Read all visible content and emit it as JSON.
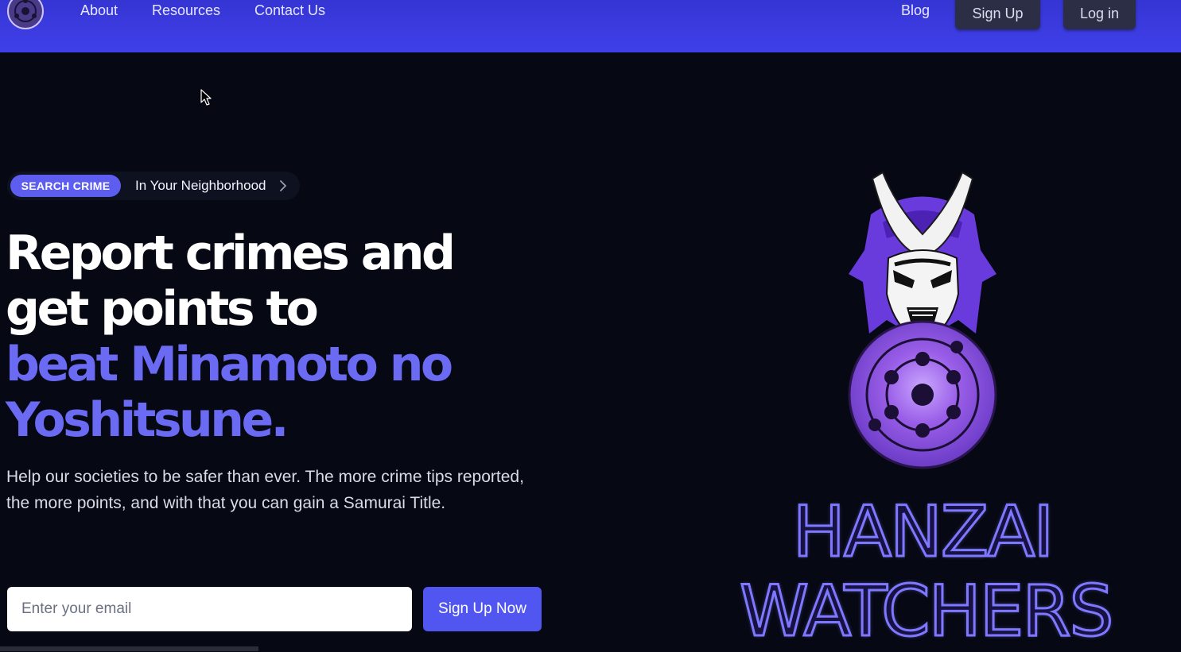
{
  "nav": {
    "links": [
      "About",
      "Resources",
      "Contact Us"
    ],
    "blog": "Blog",
    "signup": "Sign Up",
    "login": "Log in"
  },
  "hero": {
    "badge": "SEARCH CRIME",
    "badge_text": "In Your Neighborhood",
    "headline_lines": [
      "Report crimes and",
      "get points to"
    ],
    "headline_accent_lines": [
      "beat Minamoto no",
      "Yoshitsune."
    ],
    "description": "Help our societies to be safer than ever. The more crime tips reported, the more points, and with that you can gain a Samurai Title.",
    "email_placeholder": "Enter your email",
    "cta": "Sign Up Now"
  },
  "brand": {
    "lines": [
      "HANZAI",
      "WATCHERS"
    ]
  },
  "colors": {
    "nav_bg": "#3b3be0",
    "page_bg": "#060814",
    "accent": "#6a6af2",
    "button": "#5256f0",
    "nav_button": "#2b2e45"
  },
  "icons": {
    "logo": "sharingan-logo-icon",
    "cursor": "mouse-cursor-icon",
    "chevron": "chevron-right-icon",
    "hero": "samurai-mask-icon"
  }
}
